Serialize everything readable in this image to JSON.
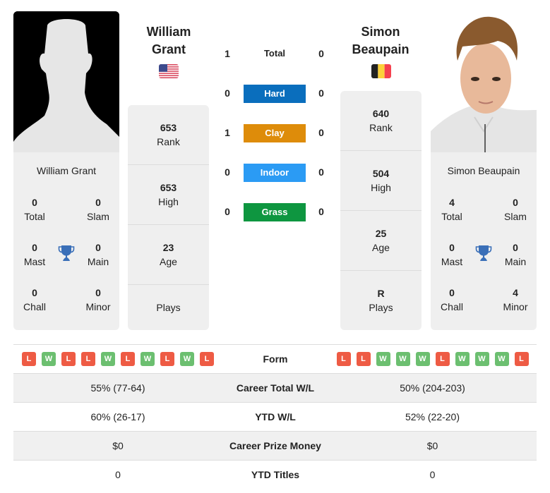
{
  "players": {
    "left": {
      "name": "William Grant",
      "name_line1": "William",
      "name_line2": "Grant",
      "country": "USA",
      "flag_icon": "us-flag-icon",
      "photo": "silhouette-placeholder",
      "titles": {
        "total": {
          "value": "0",
          "label": "Total"
        },
        "slam": {
          "value": "0",
          "label": "Slam"
        },
        "mast": {
          "value": "0",
          "label": "Mast"
        },
        "main": {
          "value": "0",
          "label": "Main"
        },
        "chall": {
          "value": "0",
          "label": "Chall"
        },
        "minor": {
          "value": "0",
          "label": "Minor"
        }
      },
      "stats": {
        "rank": {
          "value": "653",
          "label": "Rank"
        },
        "high": {
          "value": "653",
          "label": "High"
        },
        "age": {
          "value": "23",
          "label": "Age"
        },
        "plays": {
          "value": "",
          "label": "Plays"
        }
      }
    },
    "right": {
      "name": "Simon Beaupain",
      "name_line1": "Simon",
      "name_line2": "Beaupain",
      "country": "Belgium",
      "flag_icon": "belgium-flag-icon",
      "photo": "player-headshot",
      "titles": {
        "total": {
          "value": "4",
          "label": "Total"
        },
        "slam": {
          "value": "0",
          "label": "Slam"
        },
        "mast": {
          "value": "0",
          "label": "Mast"
        },
        "main": {
          "value": "0",
          "label": "Main"
        },
        "chall": {
          "value": "0",
          "label": "Chall"
        },
        "minor": {
          "value": "4",
          "label": "Minor"
        }
      },
      "stats": {
        "rank": {
          "value": "640",
          "label": "Rank"
        },
        "high": {
          "value": "504",
          "label": "High"
        },
        "age": {
          "value": "25",
          "label": "Age"
        },
        "plays": {
          "value": "R",
          "label": "Plays"
        }
      }
    }
  },
  "h2h": {
    "total": {
      "label": "Total",
      "left": "1",
      "right": "0"
    },
    "surfaces": [
      {
        "label": "Hard",
        "left": "0",
        "right": "0",
        "color": "#0a6ebd"
      },
      {
        "label": "Clay",
        "left": "1",
        "right": "0",
        "color": "#de8c0a"
      },
      {
        "label": "Indoor",
        "left": "0",
        "right": "0",
        "color": "#2b9bf4"
      },
      {
        "label": "Grass",
        "left": "0",
        "right": "0",
        "color": "#0e9640"
      }
    ]
  },
  "comparison": {
    "form": {
      "label": "Form",
      "left": [
        "L",
        "W",
        "L",
        "L",
        "W",
        "L",
        "W",
        "L",
        "W",
        "L"
      ],
      "right": [
        "L",
        "L",
        "W",
        "W",
        "W",
        "L",
        "W",
        "W",
        "W",
        "L"
      ]
    },
    "rows": [
      {
        "label": "Career Total W/L",
        "left": "55% (77-64)",
        "right": "50% (204-203)"
      },
      {
        "label": "YTD W/L",
        "left": "60% (26-17)",
        "right": "52% (22-20)"
      },
      {
        "label": "Career Prize Money",
        "left": "$0",
        "right": "$0"
      },
      {
        "label": "YTD Titles",
        "left": "0",
        "right": "0"
      }
    ]
  },
  "colors": {
    "loss": "#ee5b44",
    "win": "#6cbf70",
    "trophy": "#3a6fb8",
    "card_bg": "#efefef"
  }
}
